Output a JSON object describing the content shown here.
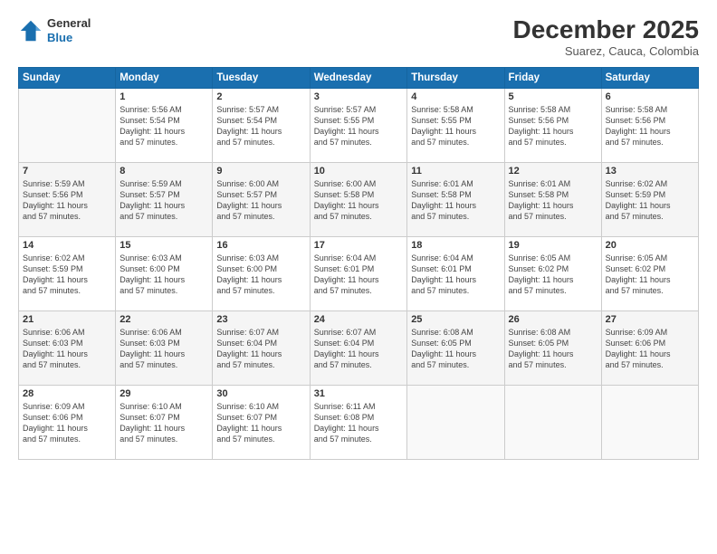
{
  "header": {
    "logo_general": "General",
    "logo_blue": "Blue",
    "month_year": "December 2025",
    "location": "Suarez, Cauca, Colombia"
  },
  "weekdays": [
    "Sunday",
    "Monday",
    "Tuesday",
    "Wednesday",
    "Thursday",
    "Friday",
    "Saturday"
  ],
  "weeks": [
    [
      {
        "day": "",
        "empty": true
      },
      {
        "day": "1",
        "sunrise": "5:56 AM",
        "sunset": "5:54 PM",
        "daylight": "11 hours and 57 minutes."
      },
      {
        "day": "2",
        "sunrise": "5:57 AM",
        "sunset": "5:54 PM",
        "daylight": "11 hours and 57 minutes."
      },
      {
        "day": "3",
        "sunrise": "5:57 AM",
        "sunset": "5:55 PM",
        "daylight": "11 hours and 57 minutes."
      },
      {
        "day": "4",
        "sunrise": "5:58 AM",
        "sunset": "5:55 PM",
        "daylight": "11 hours and 57 minutes."
      },
      {
        "day": "5",
        "sunrise": "5:58 AM",
        "sunset": "5:56 PM",
        "daylight": "11 hours and 57 minutes."
      },
      {
        "day": "6",
        "sunrise": "5:58 AM",
        "sunset": "5:56 PM",
        "daylight": "11 hours and 57 minutes."
      }
    ],
    [
      {
        "day": "7",
        "sunrise": "5:59 AM",
        "sunset": "5:56 PM",
        "daylight": "11 hours and 57 minutes."
      },
      {
        "day": "8",
        "sunrise": "5:59 AM",
        "sunset": "5:57 PM",
        "daylight": "11 hours and 57 minutes."
      },
      {
        "day": "9",
        "sunrise": "6:00 AM",
        "sunset": "5:57 PM",
        "daylight": "11 hours and 57 minutes."
      },
      {
        "day": "10",
        "sunrise": "6:00 AM",
        "sunset": "5:58 PM",
        "daylight": "11 hours and 57 minutes."
      },
      {
        "day": "11",
        "sunrise": "6:01 AM",
        "sunset": "5:58 PM",
        "daylight": "11 hours and 57 minutes."
      },
      {
        "day": "12",
        "sunrise": "6:01 AM",
        "sunset": "5:58 PM",
        "daylight": "11 hours and 57 minutes."
      },
      {
        "day": "13",
        "sunrise": "6:02 AM",
        "sunset": "5:59 PM",
        "daylight": "11 hours and 57 minutes."
      }
    ],
    [
      {
        "day": "14",
        "sunrise": "6:02 AM",
        "sunset": "5:59 PM",
        "daylight": "11 hours and 57 minutes."
      },
      {
        "day": "15",
        "sunrise": "6:03 AM",
        "sunset": "6:00 PM",
        "daylight": "11 hours and 57 minutes."
      },
      {
        "day": "16",
        "sunrise": "6:03 AM",
        "sunset": "6:00 PM",
        "daylight": "11 hours and 57 minutes."
      },
      {
        "day": "17",
        "sunrise": "6:04 AM",
        "sunset": "6:01 PM",
        "daylight": "11 hours and 57 minutes."
      },
      {
        "day": "18",
        "sunrise": "6:04 AM",
        "sunset": "6:01 PM",
        "daylight": "11 hours and 57 minutes."
      },
      {
        "day": "19",
        "sunrise": "6:05 AM",
        "sunset": "6:02 PM",
        "daylight": "11 hours and 57 minutes."
      },
      {
        "day": "20",
        "sunrise": "6:05 AM",
        "sunset": "6:02 PM",
        "daylight": "11 hours and 57 minutes."
      }
    ],
    [
      {
        "day": "21",
        "sunrise": "6:06 AM",
        "sunset": "6:03 PM",
        "daylight": "11 hours and 57 minutes."
      },
      {
        "day": "22",
        "sunrise": "6:06 AM",
        "sunset": "6:03 PM",
        "daylight": "11 hours and 57 minutes."
      },
      {
        "day": "23",
        "sunrise": "6:07 AM",
        "sunset": "6:04 PM",
        "daylight": "11 hours and 57 minutes."
      },
      {
        "day": "24",
        "sunrise": "6:07 AM",
        "sunset": "6:04 PM",
        "daylight": "11 hours and 57 minutes."
      },
      {
        "day": "25",
        "sunrise": "6:08 AM",
        "sunset": "6:05 PM",
        "daylight": "11 hours and 57 minutes."
      },
      {
        "day": "26",
        "sunrise": "6:08 AM",
        "sunset": "6:05 PM",
        "daylight": "11 hours and 57 minutes."
      },
      {
        "day": "27",
        "sunrise": "6:09 AM",
        "sunset": "6:06 PM",
        "daylight": "11 hours and 57 minutes."
      }
    ],
    [
      {
        "day": "28",
        "sunrise": "6:09 AM",
        "sunset": "6:06 PM",
        "daylight": "11 hours and 57 minutes."
      },
      {
        "day": "29",
        "sunrise": "6:10 AM",
        "sunset": "6:07 PM",
        "daylight": "11 hours and 57 minutes."
      },
      {
        "day": "30",
        "sunrise": "6:10 AM",
        "sunset": "6:07 PM",
        "daylight": "11 hours and 57 minutes."
      },
      {
        "day": "31",
        "sunrise": "6:11 AM",
        "sunset": "6:08 PM",
        "daylight": "11 hours and 57 minutes."
      },
      {
        "day": "",
        "empty": true
      },
      {
        "day": "",
        "empty": true
      },
      {
        "day": "",
        "empty": true
      }
    ]
  ],
  "labels": {
    "sunrise_prefix": "Sunrise: ",
    "sunset_prefix": "Sunset: ",
    "daylight_prefix": "Daylight: "
  }
}
